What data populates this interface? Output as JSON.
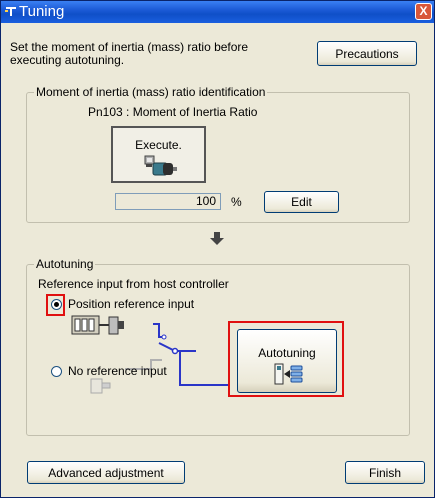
{
  "window": {
    "title": "Tuning",
    "close_glyph": "X"
  },
  "intro": {
    "text_line1": "Set the moment of inertia (mass) ratio before",
    "text_line2": "executing autotuning.",
    "precautions_label": "Precautions"
  },
  "inertia_group": {
    "label": "Moment of inertia (mass) ratio identification",
    "param_label": "Pn103 : Moment of Inertia Ratio",
    "execute_label": "Execute.",
    "value": "100",
    "unit": "%",
    "edit_label": "Edit"
  },
  "autotuning_group": {
    "label": "Autotuning",
    "reference_label": "Reference input from host controller",
    "options": [
      {
        "label": "Position reference input",
        "selected": true
      },
      {
        "label": "No reference input",
        "selected": false
      }
    ],
    "autotuning_button_label": "Autotuning"
  },
  "footer": {
    "advanced_label": "Advanced adjustment",
    "finish_label": "Finish"
  },
  "colors": {
    "titlebar": "#1c5bd6",
    "highlight": "#e01010",
    "wire": "#2a35c8",
    "window_bg": "#ece9d8"
  },
  "icons": [
    "tuning-app-icon",
    "close-icon",
    "servo-motor-icon",
    "down-arrow-icon",
    "host-controller-icon",
    "wiring-icon",
    "autotuning-icon"
  ]
}
